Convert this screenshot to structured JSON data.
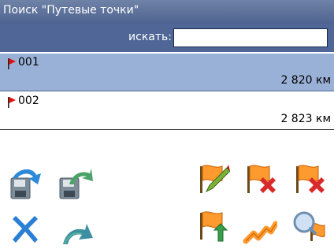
{
  "window": {
    "title": "Поиск \"Путевые точки\""
  },
  "search": {
    "label": "искать:",
    "value": ""
  },
  "waypoints": [
    {
      "name": "001",
      "distance": "2 820 км",
      "selected": true
    },
    {
      "name": "002",
      "distance": "2 823 км",
      "selected": false
    }
  ],
  "toolbar": {
    "left_icons": [
      "save-arrow-icon",
      "save-curved-arrow-icon",
      "close-x-icon",
      "undo-curved-arrow-icon"
    ],
    "right_icons": [
      "flag-edit-icon",
      "flag-delete-icon",
      "flag-delete-alt-icon",
      "flag-upload-icon",
      "flag-route-icon",
      "flag-search-icon"
    ]
  },
  "colors": {
    "titlebar": "#5a6f9a",
    "selected_row": "#9ab1d7",
    "flag": "#ff9a2e",
    "accent_blue": "#2b7fd6"
  }
}
